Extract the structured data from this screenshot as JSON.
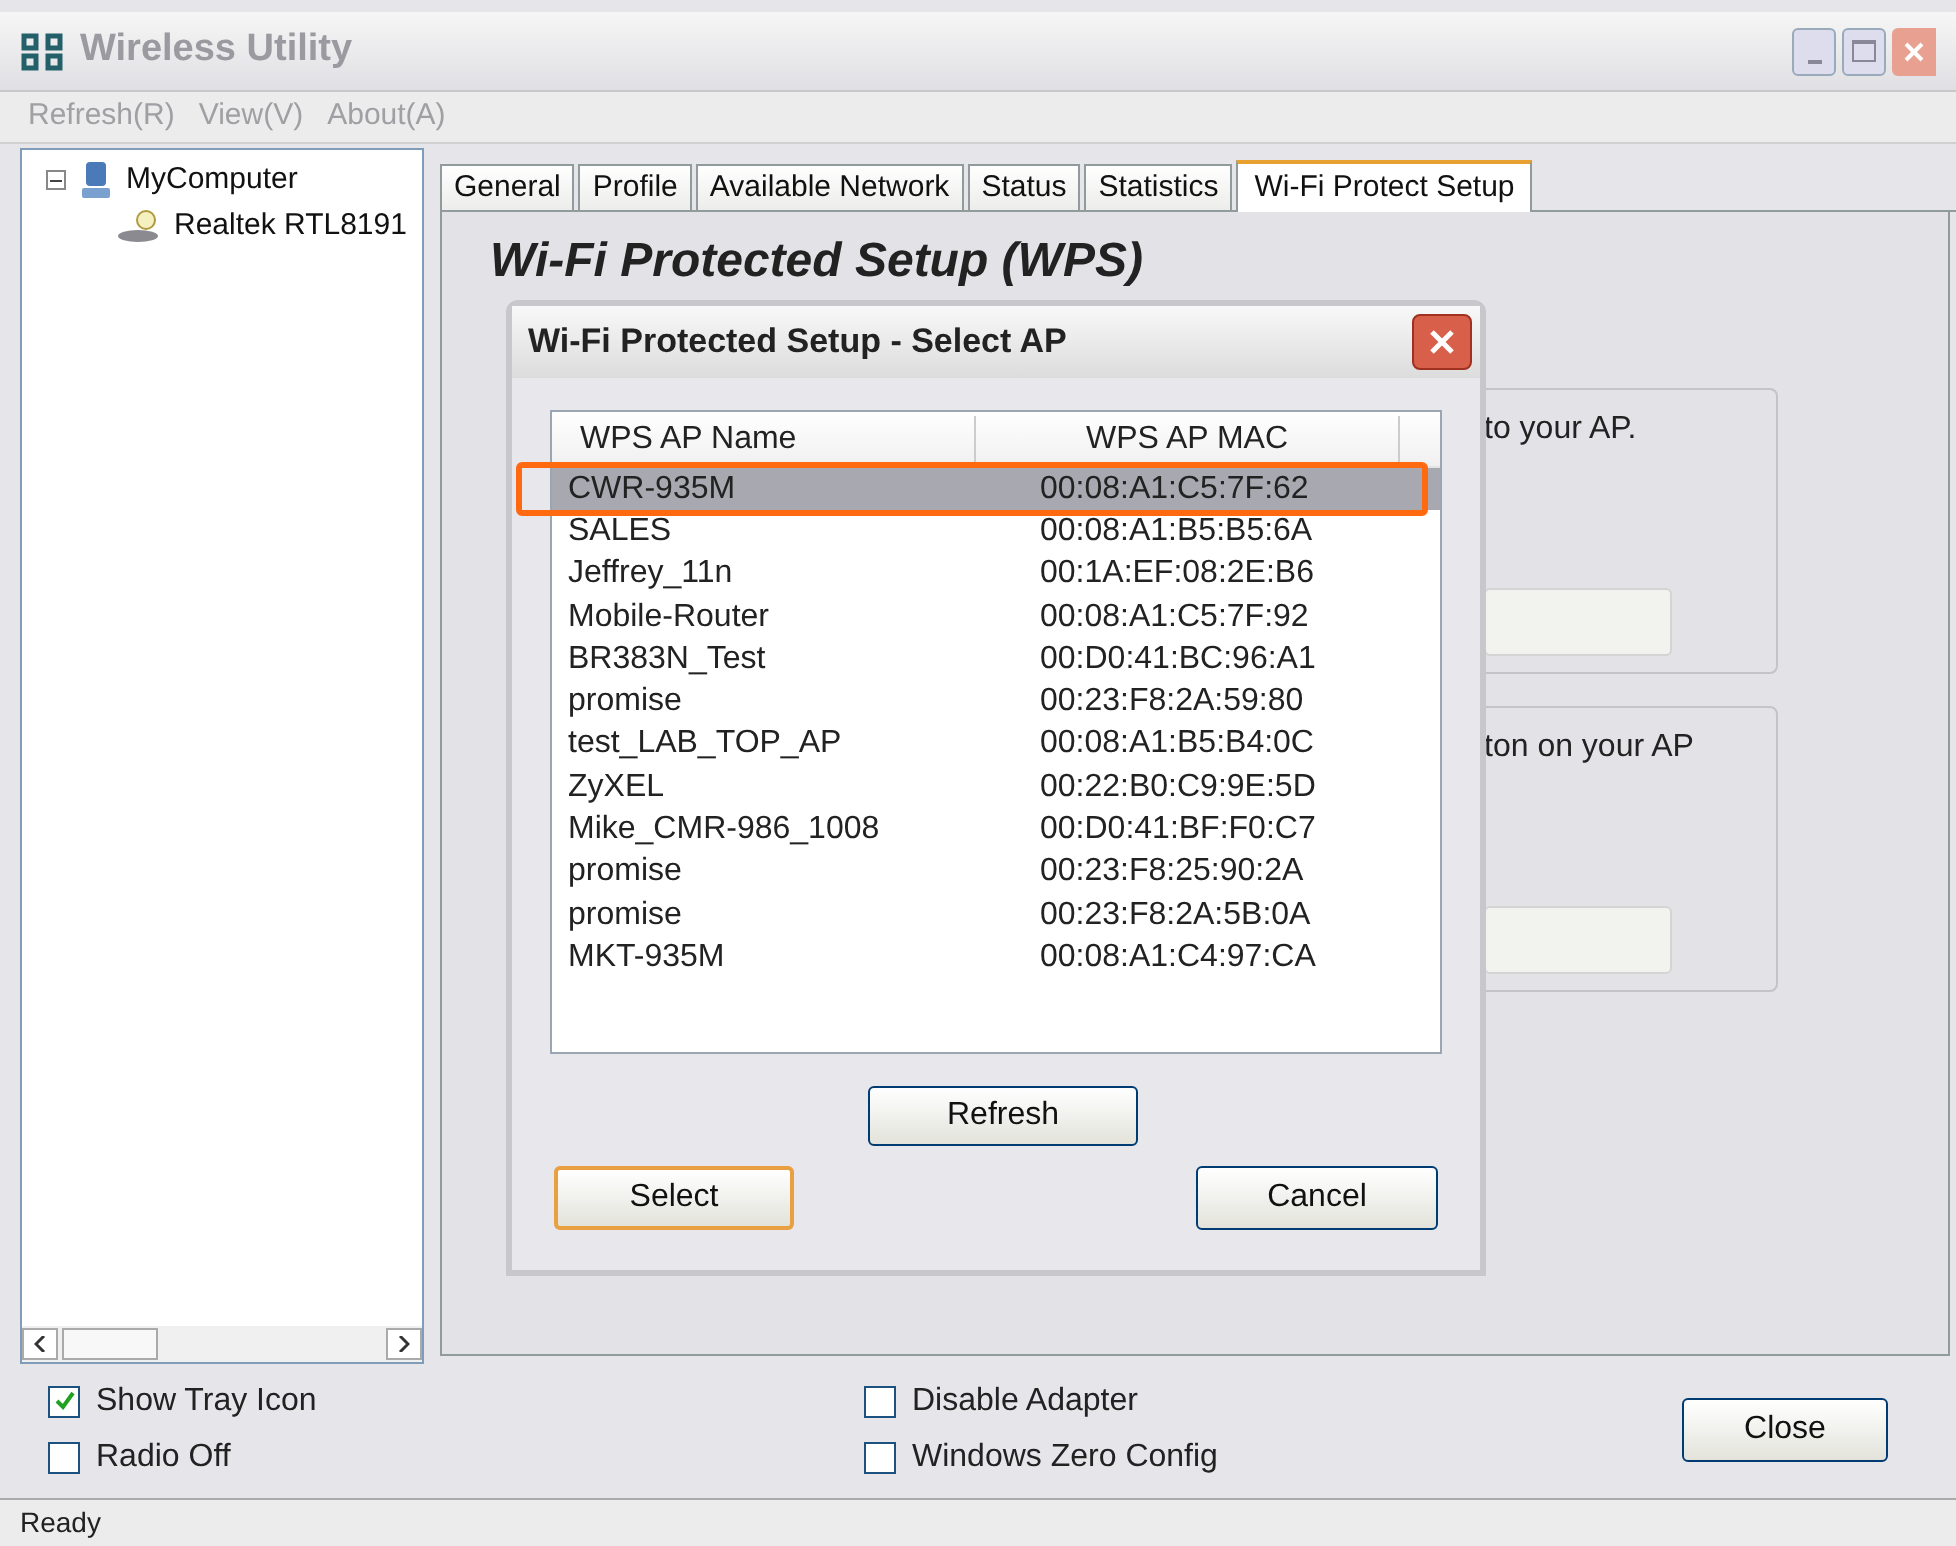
{
  "window": {
    "title": "Wireless Utility"
  },
  "menu": [
    "Refresh(R)",
    "View(V)",
    "About(A)"
  ],
  "tree": [
    {
      "label": "MyComputer",
      "expanded": true,
      "children": [
        {
          "label": "Realtek RTL8191"
        }
      ]
    }
  ],
  "tabs": [
    {
      "label": "General",
      "selected": false
    },
    {
      "label": "Profile",
      "selected": false
    },
    {
      "label": "Available Network",
      "selected": false
    },
    {
      "label": "Status",
      "selected": false
    },
    {
      "label": "Statistics",
      "selected": false
    },
    {
      "label": "Wi-Fi Protect Setup",
      "selected": true
    }
  ],
  "wps": {
    "heading": "Wi-Fi Protected Setup (WPS)",
    "group_texts": [
      "to your AP.",
      "ton on your AP"
    ]
  },
  "dialog": {
    "title": "Wi-Fi Protected Setup - Select AP",
    "columns": [
      "WPS AP Name",
      "WPS AP MAC"
    ],
    "rows": [
      {
        "name": "CWR-935M",
        "mac": "00:08:A1:C5:7F:62",
        "selected": true
      },
      {
        "name": "SALES",
        "mac": "00:08:A1:B5:B5:6A",
        "selected": false
      },
      {
        "name": "Jeffrey_11n",
        "mac": "00:1A:EF:08:2E:B6",
        "selected": false
      },
      {
        "name": "Mobile-Router",
        "mac": "00:08:A1:C5:7F:92",
        "selected": false
      },
      {
        "name": "BR383N_Test",
        "mac": "00:D0:41:BC:96:A1",
        "selected": false
      },
      {
        "name": "promise",
        "mac": "00:23:F8:2A:59:80",
        "selected": false
      },
      {
        "name": "test_LAB_TOP_AP",
        "mac": "00:08:A1:B5:B4:0C",
        "selected": false
      },
      {
        "name": "ZyXEL",
        "mac": "00:22:B0:C9:9E:5D",
        "selected": false
      },
      {
        "name": "Mike_CMR-986_1008",
        "mac": "00:D0:41:BF:F0:C7",
        "selected": false
      },
      {
        "name": "promise",
        "mac": "00:23:F8:25:90:2A",
        "selected": false
      },
      {
        "name": "promise",
        "mac": "00:23:F8:2A:5B:0A",
        "selected": false
      },
      {
        "name": "MKT-935M",
        "mac": "00:08:A1:C4:97:CA",
        "selected": false
      }
    ],
    "refresh_button": "Refresh",
    "select_button": "Select",
    "cancel_button": "Cancel"
  },
  "options": [
    {
      "label": "Show Tray Icon",
      "checked": true
    },
    {
      "label": "Disable Adapter",
      "checked": false
    },
    {
      "label": "Radio Off",
      "checked": false
    },
    {
      "label": "Windows Zero Config",
      "checked": false
    }
  ],
  "close_button": "Close",
  "status_bar": "Ready"
}
